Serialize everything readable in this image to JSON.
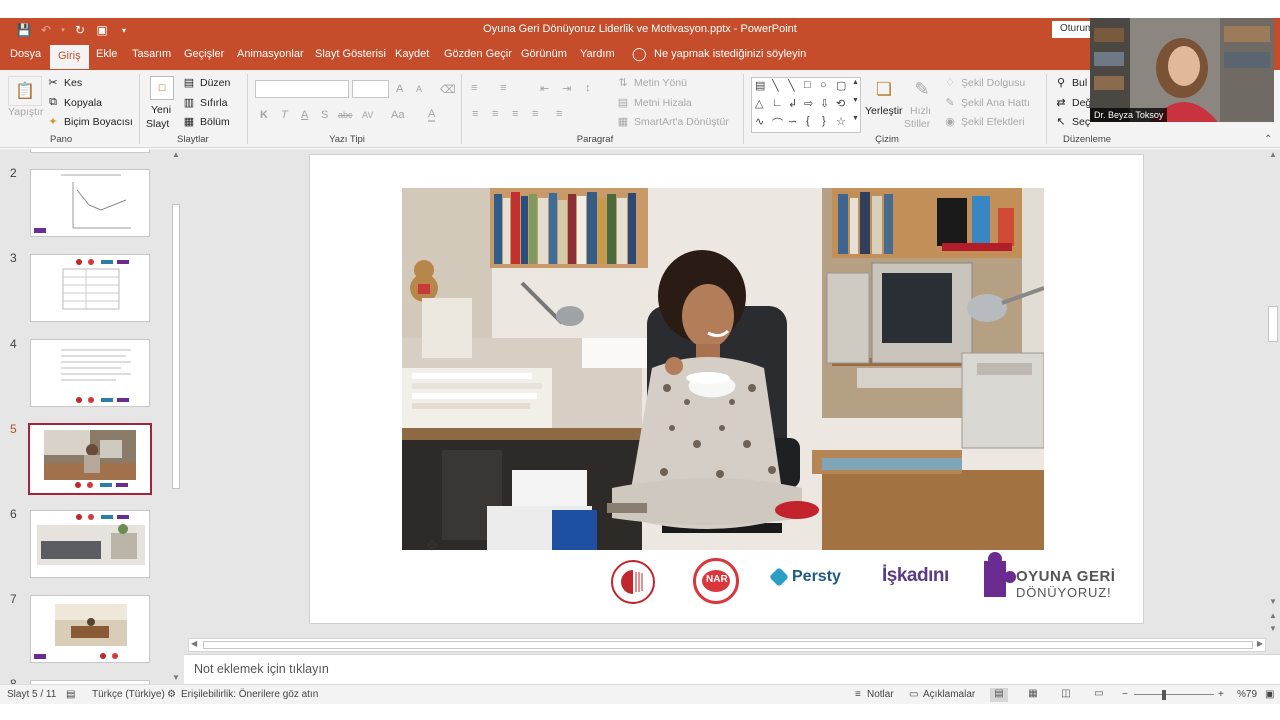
{
  "window": {
    "title": "Oyuna Geri Dönüyoruz Liderlik ve Motivasyon.pptx  -  PowerPoint",
    "signin_label": "Oturum"
  },
  "tabs": [
    "Dosya",
    "Giriş",
    "Ekle",
    "Tasarım",
    "Geçişler",
    "Animasyonlar",
    "Slayt Gösterisi",
    "Kaydet",
    "Gözden Geçir",
    "Görünüm",
    "Yardım"
  ],
  "tell_me": "Ne yapmak istediğinizi söyleyin",
  "ribbon": {
    "clipboard": {
      "paste": "Yapıştır",
      "cut": "Kes",
      "copy": "Kopyala",
      "format_painter": "Biçim Boyacısı",
      "group": "Pano"
    },
    "slides": {
      "new_slide_1": "Yeni",
      "new_slide_2": "Slayt",
      "layout": "Düzen",
      "reset": "Sıfırla",
      "section": "Bölüm",
      "group": "Slaytlar"
    },
    "font": {
      "group": "Yazı Tipi",
      "bold": "K",
      "italic": "T",
      "underline": "A",
      "shadow": "S",
      "strike": "abc",
      "spacing": "AV",
      "case": "Aa",
      "color": "A",
      "grow": "A",
      "shrink": "A"
    },
    "paragraph": {
      "text_direction": "Metin Yönü",
      "align_text": "Metni Hizala",
      "smartart": "SmartArt'a Dönüştür",
      "group": "Paragraf"
    },
    "drawing": {
      "arrange": "Yerleştir",
      "quick_styles_1": "Hızlı",
      "quick_styles_2": "Stiller",
      "fill": "Şekil Dolgusu",
      "outline": "Şekil Ana Hattı",
      "effects": "Şekil Efektleri",
      "group": "Çizim"
    },
    "editing": {
      "find": "Bul",
      "replace": "Değ",
      "select": "Seç",
      "group": "Düzenleme"
    }
  },
  "thumbnails": [
    {
      "number": "2"
    },
    {
      "number": "3"
    },
    {
      "number": "4"
    },
    {
      "number": "5"
    },
    {
      "number": "6"
    },
    {
      "number": "7"
    },
    {
      "number": "8"
    }
  ],
  "slide": {
    "logos": {
      "dogus": "DOĞUŞ ÜNİVERSİTESİ",
      "nar": "NAR",
      "persty": "Persty",
      "iskadini": "İşkadını",
      "oyuna_1": "OYUNA GERİ",
      "oyuna_2": "DÖNÜYORUZ!"
    }
  },
  "notes_placeholder": "Not eklemek için tıklayın",
  "status": {
    "slide_counter": "Slayt 5 / 11",
    "language": "Türkçe (Türkiye)",
    "accessibility": "Erişilebilirlik: Önerilere göz atın",
    "notes": "Notlar",
    "comments": "Açıklamalar",
    "zoom": "%79"
  },
  "webcam": {
    "name": "Dr. Beyza Toksoy"
  },
  "colors": {
    "accent": "#c54d2b",
    "selected_thumb": "#a3233a",
    "oyuna_purple": "#6b2c91"
  }
}
